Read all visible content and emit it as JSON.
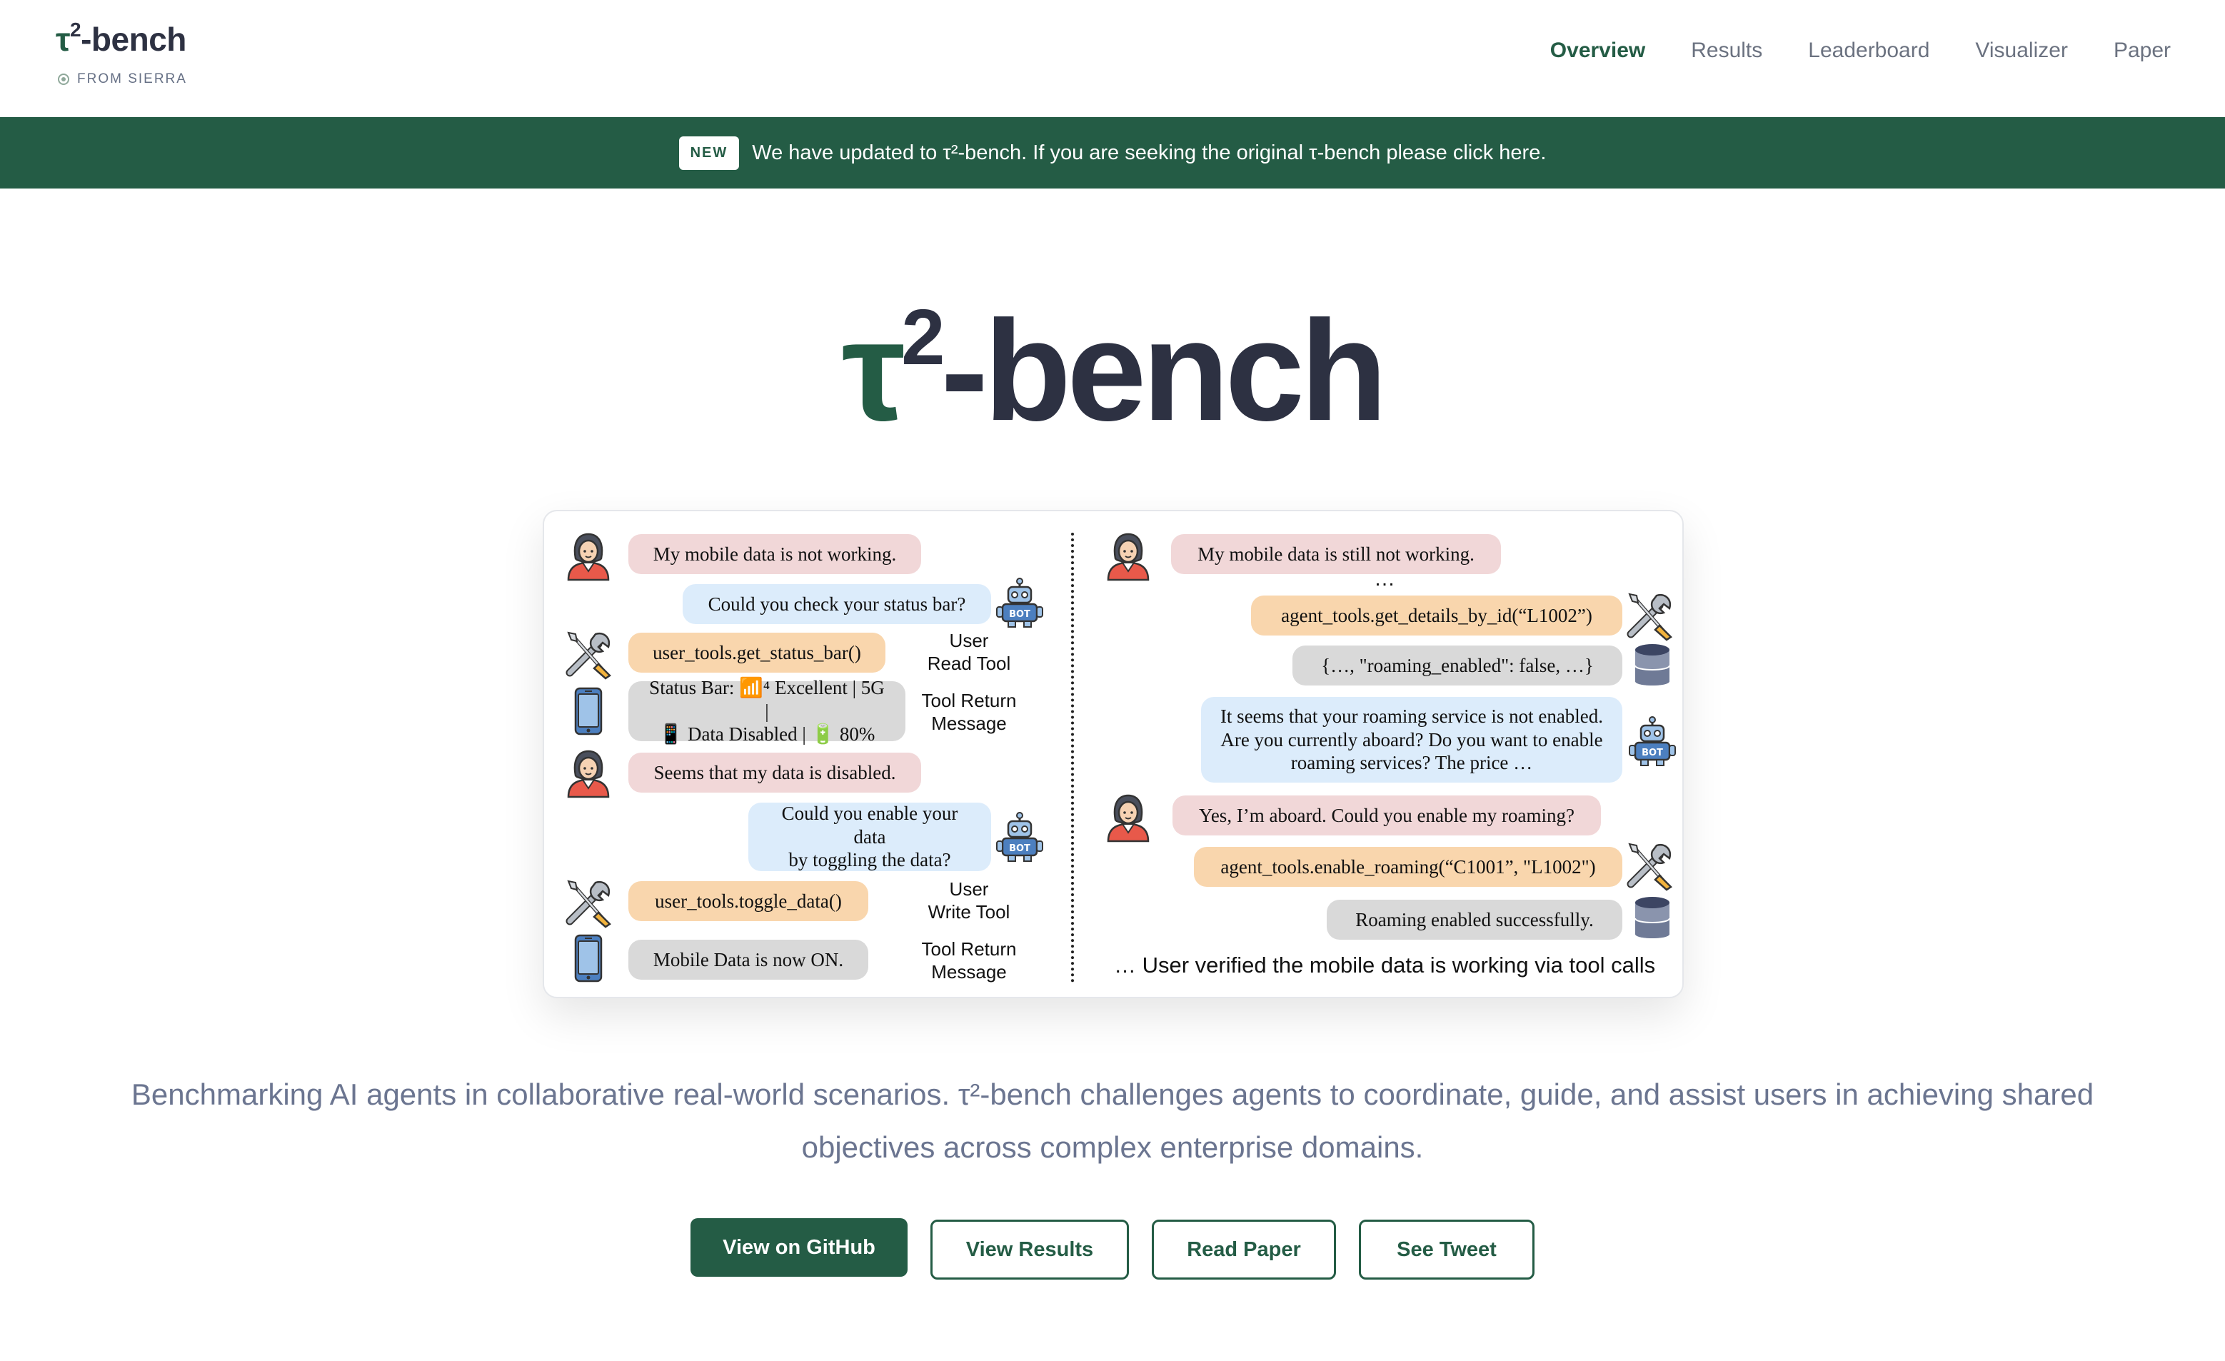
{
  "header": {
    "logo_tau": "τ",
    "logo_sup": "2",
    "logo_rest": "-bench",
    "from_label": "FROM SIERRA",
    "nav": [
      {
        "label": "Overview",
        "active": true
      },
      {
        "label": "Results",
        "active": false
      },
      {
        "label": "Leaderboard",
        "active": false
      },
      {
        "label": "Visualizer",
        "active": false
      },
      {
        "label": "Paper",
        "active": false
      }
    ]
  },
  "banner": {
    "badge": "NEW",
    "text": "We have updated to τ²-bench. If you are seeking the original τ-bench please click here."
  },
  "hero": {
    "tau": "τ",
    "sup": "2",
    "rest": "-bench"
  },
  "figure": {
    "left": {
      "user_msg_1": "My mobile data is not working.",
      "agent_msg_1": "Could you check your status bar?",
      "tool_call_1": "user_tools.get_status_bar()",
      "tool_call_1_side": "User\nRead Tool",
      "tool_return_1": "Status Bar: 📶⁴ Excellent | 5G |\n📱 Data Disabled | 🔋 80%",
      "tool_return_1_side": "Tool Return\nMessage",
      "user_msg_2": "Seems that my data is disabled.",
      "agent_msg_2": "Could you enable your data\nby toggling the data?",
      "tool_call_2": "user_tools.toggle_data()",
      "tool_call_2_side": "User\nWrite Tool",
      "tool_return_2": "Mobile Data is now ON.",
      "tool_return_2_side": "Tool Return\nMessage"
    },
    "right": {
      "user_msg_1": "My mobile data is still not working.",
      "ellipsis": "…",
      "tool_call_1": "agent_tools.get_details_by_id(“L1002”)",
      "tool_return_1": "{…, \"roaming_enabled\": false, …}",
      "agent_msg_1": "It seems that your roaming service is not enabled.\nAre you currently aboard? Do you want to enable\nroaming services? The price …",
      "user_msg_2": "Yes, I’m aboard. Could you enable my roaming?",
      "tool_call_2": "agent_tools.enable_roaming(“C1001”, \"L1002\")",
      "tool_return_2": "Roaming enabled successfully.",
      "footnote": "… User verified the mobile data is working via tool calls"
    },
    "icons": {
      "user": "user-avatar-icon",
      "bot": "robot-icon",
      "tools": "wrench-screwdriver-icon",
      "phone": "smartphone-icon",
      "database": "database-icon"
    }
  },
  "description": "Benchmarking AI agents in collaborative real-world scenarios. τ²-bench challenges agents to coordinate, guide, and assist users in achieving shared objectives across complex enterprise domains.",
  "buttons": {
    "github": "View on GitHub",
    "results": "View Results",
    "paper": "Read Paper",
    "tweet": "See Tweet"
  },
  "colors": {
    "brand_green": "#245c45",
    "title_dark": "#2d3142",
    "user_bubble": "#f1d7d8",
    "agent_bubble": "#dcecfb",
    "tool_call_bubble": "#f9d6ad",
    "tool_return_bubble": "#d9d9d9"
  }
}
